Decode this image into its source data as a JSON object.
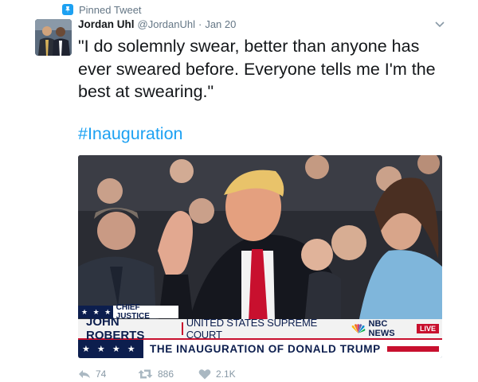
{
  "pinned": {
    "label": "Pinned Tweet"
  },
  "tweet": {
    "author_name": "Jordan Uhl",
    "author_handle": "@JordanUhl",
    "separator": "·",
    "date": "Jan 20",
    "text": "\"I do solemnly swear, better than anyone has ever sweared before. Everyone tells me I'm the best at swearing.\"",
    "hashtag": "#Inauguration"
  },
  "media": {
    "chyron": {
      "stars_small": "★ ★ ★",
      "role": "CHIEF JUSTICE",
      "name": "JOHN ROBERTS",
      "court": "UNITED STATES SUPREME COURT",
      "network": "NBC NEWS",
      "live": "LIVE",
      "stars_large": "★ ★ ★ ★",
      "event_prefix": "THE INAUGURATION OF ",
      "event_name": "DONALD TRUMP"
    }
  },
  "actions": {
    "replies": "74",
    "retweets": "886",
    "likes": "2.1K"
  },
  "colors": {
    "accent": "#1da1f2",
    "muted": "#657786",
    "chyron_navy": "#0c1e4e",
    "chyron_red": "#c8102e"
  }
}
